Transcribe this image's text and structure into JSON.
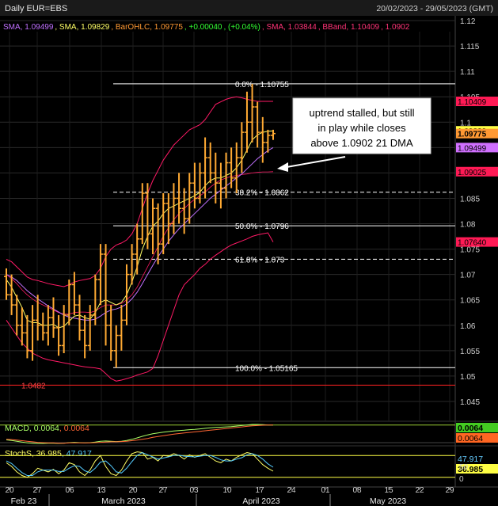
{
  "header": {
    "title": "Daily EUR=EBS",
    "date_range": "20/02/2023 - 29/05/2023 (GMT)"
  },
  "legend": [
    {
      "text": "SMA, 1.09499",
      "color": "#c070ff"
    },
    {
      "text": "SMA, 1.09829",
      "color": "#ffff66"
    },
    {
      "text": "BarOHLC, 1.09775",
      "color": "#ff9933"
    },
    {
      "text": "+0.00040",
      "color": "#33ff33"
    },
    {
      "text": "(+0.04%)",
      "color": "#33ff33"
    },
    {
      "text": "SMA, 1.03844",
      "color": "#ff3377"
    },
    {
      "text": "BBand, 1.10409",
      "color": "#ff3377"
    },
    {
      "text": "1.0902",
      "color": "#ff3377"
    }
  ],
  "annotation": {
    "lines": [
      "uptrend stalled, but still",
      "in play while closes",
      "above 1.0902 21 DMA"
    ]
  },
  "macd_panel": {
    "label": "MACD",
    "v1": "0.0064",
    "v2": "0.0064",
    "tag1": "0.0064",
    "tag2": "0.0064"
  },
  "stoch_panel": {
    "label": "StochS",
    "v1": "36.985",
    "v2": "47.917",
    "tag1": "47.917",
    "tag2": "36.985",
    "axis": [
      "50",
      "0"
    ]
  },
  "x_axis": {
    "days": [
      "20",
      "27",
      "06",
      "13",
      "20",
      "27",
      "03",
      "10",
      "17",
      "24",
      "01",
      "08",
      "15",
      "22",
      "29"
    ],
    "months": [
      "Feb 23",
      "March 2023",
      "April 2023",
      "May 2023"
    ]
  },
  "price_tags": [
    {
      "text": "1.09829",
      "value": 1.09829,
      "bg": "#ffff44",
      "fg": "#000"
    },
    {
      "text": "1.09775",
      "value": 1.09775,
      "bg": "#ff9933",
      "fg": "#000"
    },
    {
      "text": "1.09499",
      "value": 1.09499,
      "bg": "#d070ff",
      "fg": "#000"
    },
    {
      "text": "1.10409",
      "value": 1.10409,
      "bg": "#ff1a55",
      "fg": "#000"
    },
    {
      "text": "1.09025",
      "value": 1.09025,
      "bg": "#ff1a55",
      "fg": "#000"
    },
    {
      "text": "1.07640",
      "value": 1.0764,
      "bg": "#ff1a55",
      "fg": "#000"
    }
  ],
  "chart_data": {
    "type": "bar",
    "subtype": "ohlc",
    "ylim": [
      1.04,
      1.12
    ],
    "yticks": [
      1.045,
      1.05,
      1.055,
      1.06,
      1.065,
      1.07,
      1.075,
      1.08,
      1.085,
      1.09,
      1.095,
      1.1,
      1.105,
      1.11,
      1.115,
      1.12
    ],
    "ytick_labels": [
      "1.045",
      "1.05",
      "1.055",
      "1.06",
      "1.065",
      "1.07",
      "1.075",
      "1.08",
      "1.085",
      "1.09",
      "1.095",
      "1.1",
      "1.105",
      "1.11",
      "1.115",
      "1.12"
    ],
    "ohlc": [
      [
        1.0696,
        1.0712,
        1.065,
        1.066
      ],
      [
        1.066,
        1.07,
        1.062,
        1.064
      ],
      [
        1.064,
        1.066,
        1.058,
        1.06
      ],
      [
        1.06,
        1.0635,
        1.056,
        1.0585
      ],
      [
        1.0585,
        1.062,
        1.0535,
        1.055
      ],
      [
        1.055,
        1.064,
        1.053,
        1.061
      ],
      [
        1.061,
        1.066,
        1.057,
        1.06
      ],
      [
        1.06,
        1.0625,
        1.057,
        1.0585
      ],
      [
        1.0585,
        1.064,
        1.056,
        1.0615
      ],
      [
        1.0615,
        1.0655,
        1.0575,
        1.0595
      ],
      [
        1.0595,
        1.062,
        1.054,
        1.056
      ],
      [
        1.056,
        1.064,
        1.0545,
        1.062
      ],
      [
        1.062,
        1.069,
        1.06,
        1.068
      ],
      [
        1.068,
        1.0705,
        1.062,
        1.064
      ],
      [
        1.064,
        1.066,
        1.057,
        1.059
      ],
      [
        1.059,
        1.062,
        1.0535,
        1.056
      ],
      [
        1.056,
        1.064,
        1.055,
        1.062
      ],
      [
        1.062,
        1.07,
        1.06,
        1.069
      ],
      [
        1.069,
        1.076,
        1.064,
        1.074
      ],
      [
        1.074,
        1.076,
        1.056,
        1.06
      ],
      [
        1.06,
        1.064,
        1.053,
        1.055
      ],
      [
        1.055,
        1.06,
        1.05165,
        1.058
      ],
      [
        1.058,
        1.064,
        1.055,
        1.061
      ],
      [
        1.061,
        1.072,
        1.06,
        1.07
      ],
      [
        1.07,
        1.076,
        1.068,
        1.074
      ],
      [
        1.074,
        1.08,
        1.07,
        1.077
      ],
      [
        1.077,
        1.088,
        1.076,
        1.086
      ],
      [
        1.086,
        1.088,
        1.075,
        1.078
      ],
      [
        1.078,
        1.085,
        1.074,
        1.083
      ],
      [
        1.083,
        1.084,
        1.072,
        1.076
      ],
      [
        1.076,
        1.086,
        1.074,
        1.084
      ],
      [
        1.084,
        1.086,
        1.076,
        1.08
      ],
      [
        1.08,
        1.088,
        1.078,
        1.085
      ],
      [
        1.085,
        1.09,
        1.08,
        1.083
      ],
      [
        1.083,
        1.087,
        1.078,
        1.081
      ],
      [
        1.081,
        1.09,
        1.08,
        1.088
      ],
      [
        1.088,
        1.092,
        1.083,
        1.085
      ],
      [
        1.085,
        1.092,
        1.084,
        1.09
      ],
      [
        1.09,
        1.097,
        1.085,
        1.093
      ],
      [
        1.093,
        1.096,
        1.088,
        1.09
      ],
      [
        1.09,
        1.094,
        1.084,
        1.088
      ],
      [
        1.088,
        1.092,
        1.083,
        1.087
      ],
      [
        1.087,
        1.094,
        1.085,
        1.092
      ],
      [
        1.092,
        1.095,
        1.087,
        1.089
      ],
      [
        1.089,
        1.096,
        1.086,
        1.093
      ],
      [
        1.093,
        1.1,
        1.09,
        1.098
      ],
      [
        1.098,
        1.106,
        1.094,
        1.1
      ],
      [
        1.1,
        1.1075,
        1.096,
        1.103
      ],
      [
        1.103,
        1.104,
        1.095,
        1.098
      ],
      [
        1.098,
        1.101,
        1.092,
        1.096
      ],
      [
        1.096,
        1.0985,
        1.094,
        1.0974
      ],
      [
        1.0974,
        1.0985,
        1.0965,
        1.09775
      ]
    ],
    "sma_fast": [
      1.069,
      1.0675,
      1.0655,
      1.0635,
      1.061,
      1.0605,
      1.0605,
      1.06,
      1.06,
      1.0602,
      1.0595,
      1.0598,
      1.0608,
      1.0618,
      1.062,
      1.0615,
      1.0612,
      1.0625,
      1.0645,
      1.065,
      1.0645,
      1.064,
      1.0645,
      1.066,
      1.0685,
      1.0715,
      1.075,
      1.0775,
      1.0795,
      1.0805,
      1.082,
      1.083,
      1.0835,
      1.084,
      1.0845,
      1.085,
      1.0855,
      1.0862,
      1.0875,
      1.0885,
      1.089,
      1.089,
      1.0895,
      1.09,
      1.091,
      1.0925,
      1.0945,
      1.0965,
      1.0975,
      1.098,
      1.0982,
      1.09829
    ],
    "sma_slow": [
      1.07,
      1.0695,
      1.0688,
      1.0678,
      1.0668,
      1.066,
      1.0652,
      1.0645,
      1.0638,
      1.0632,
      1.0626,
      1.062,
      1.0616,
      1.0614,
      1.0612,
      1.061,
      1.061,
      1.0612,
      1.0618,
      1.0625,
      1.063,
      1.0632,
      1.0636,
      1.0642,
      1.0652,
      1.0665,
      1.0682,
      1.07,
      1.0718,
      1.0735,
      1.075,
      1.0765,
      1.0778,
      1.079,
      1.08,
      1.081,
      1.082,
      1.083,
      1.084,
      1.085,
      1.0858,
      1.0866,
      1.0874,
      1.0882,
      1.089,
      1.0898,
      1.0908,
      1.0918,
      1.0928,
      1.0936,
      1.0944,
      1.09499
    ],
    "bband_upper": [
      1.073,
      1.0725,
      1.0715,
      1.0705,
      1.0695,
      1.069,
      1.0688,
      1.0685,
      1.0682,
      1.068,
      1.0678,
      1.0676,
      1.068,
      1.0685,
      1.0688,
      1.069,
      1.0692,
      1.0698,
      1.0712,
      1.0735,
      1.075,
      1.0758,
      1.0762,
      1.0768,
      1.078,
      1.08,
      1.083,
      1.086,
      1.0885,
      1.0905,
      1.0925,
      1.094,
      1.0955,
      1.0965,
      1.0975,
      1.0985,
      1.099,
      1.0995,
      1.1005,
      1.102,
      1.1035,
      1.104,
      1.1045,
      1.1048,
      1.105,
      1.1048,
      1.1045,
      1.1043,
      1.1041,
      1.1041,
      1.1041,
      1.10409
    ],
    "bband_lower": [
      1.061,
      1.0595,
      1.058,
      1.0565,
      1.0555,
      1.0545,
      1.054,
      1.0535,
      1.0532,
      1.053,
      1.0528,
      1.0526,
      1.0524,
      1.0522,
      1.052,
      1.0518,
      1.0517,
      1.0516,
      1.0514,
      1.0505,
      1.0495,
      1.049,
      1.0492,
      1.0495,
      1.0498,
      1.0502,
      1.0505,
      1.0508,
      1.0515,
      1.054,
      1.057,
      1.06,
      1.063,
      1.066,
      1.068,
      1.069,
      1.07,
      1.0712,
      1.072,
      1.073,
      1.0738,
      1.0745,
      1.0752,
      1.0758,
      1.0762,
      1.0766,
      1.077,
      1.0775,
      1.0778,
      1.078,
      1.0782,
      1.0764
    ],
    "bband_mid": [
      1.07,
      1.0692,
      1.0682,
      1.067,
      1.066,
      1.0652,
      1.0645,
      1.064,
      1.0635,
      1.063,
      1.0625,
      1.0622,
      1.0622,
      1.0625,
      1.0626,
      1.0626,
      1.0625,
      1.0628,
      1.0635,
      1.064,
      1.064,
      1.064,
      1.0643,
      1.065,
      1.066,
      1.0675,
      1.0695,
      1.0715,
      1.0735,
      1.0755,
      1.0775,
      1.0792,
      1.0808,
      1.082,
      1.083,
      1.084,
      1.0848,
      1.0855,
      1.0862,
      1.0872,
      1.088,
      1.0886,
      1.089,
      1.0893,
      1.0895,
      1.0897,
      1.0898,
      1.09,
      1.0901,
      1.0902,
      1.0902,
      1.09025
    ],
    "fib_levels": [
      {
        "label": "0.0% - 1.10755",
        "value": 1.10755,
        "style": "solid"
      },
      {
        "label": "38.2% - 1.0862",
        "value": 1.0862,
        "style": "dashed"
      },
      {
        "label": "50.0% - 1.0796",
        "value": 1.0796,
        "style": "solid"
      },
      {
        "label": "61.8% - 1.073",
        "value": 1.073,
        "style": "dashed"
      },
      {
        "label": "100.0% - 1.05165",
        "value": 1.05165,
        "style": "solid"
      }
    ],
    "hline": {
      "label": "1.0482",
      "value": 1.0482,
      "color": "#ff2222"
    },
    "macd": [
      0.001,
      0.0008,
      0.0005,
      0.0002,
      -0.0001,
      -0.0002,
      -0.0003,
      -0.0003,
      -0.0002,
      -0.0002,
      -0.0003,
      -0.0002,
      0.0,
      0.0001,
      0.0,
      -0.0001,
      0.0,
      0.0002,
      0.0005,
      0.0006,
      0.0005,
      0.0004,
      0.0005,
      0.0008,
      0.0012,
      0.0017,
      0.0023,
      0.0028,
      0.0032,
      0.0035,
      0.0038,
      0.004,
      0.0042,
      0.0044,
      0.0045,
      0.0047,
      0.0048,
      0.005,
      0.0052,
      0.0054,
      0.0055,
      0.0056,
      0.0057,
      0.0058,
      0.006,
      0.0062,
      0.0064,
      0.0066,
      0.0066,
      0.0065,
      0.0064,
      0.0064
    ],
    "macd_signal": [
      0.0012,
      0.0011,
      0.0009,
      0.0007,
      0.0005,
      0.0003,
      0.0001,
      0.0,
      -0.0001,
      -0.0001,
      -0.0002,
      -0.0002,
      -0.0001,
      -0.0001,
      -0.0001,
      -0.0001,
      -0.0001,
      0.0,
      0.0001,
      0.0002,
      0.0003,
      0.0003,
      0.0004,
      0.0005,
      0.0007,
      0.0009,
      0.0012,
      0.0015,
      0.0019,
      0.0022,
      0.0025,
      0.0028,
      0.0031,
      0.0033,
      0.0035,
      0.0037,
      0.0039,
      0.0041,
      0.0043,
      0.0045,
      0.0047,
      0.0049,
      0.0051,
      0.0053,
      0.0055,
      0.0057,
      0.0059,
      0.0061,
      0.0062,
      0.0063,
      0.0064,
      0.0064
    ],
    "stoch_k": [
      60,
      50,
      35,
      25,
      20,
      30,
      45,
      40,
      35,
      42,
      30,
      40,
      60,
      55,
      35,
      25,
      40,
      65,
      80,
      50,
      30,
      25,
      40,
      65,
      85,
      90,
      88,
      70,
      75,
      65,
      80,
      78,
      85,
      80,
      70,
      82,
      75,
      80,
      85,
      75,
      65,
      60,
      70,
      65,
      75,
      82,
      88,
      85,
      70,
      55,
      45,
      36.985
    ],
    "stoch_d": [
      65,
      58,
      45,
      33,
      25,
      25,
      35,
      40,
      40,
      40,
      36,
      36,
      45,
      52,
      50,
      38,
      33,
      45,
      62,
      65,
      52,
      35,
      32,
      45,
      63,
      80,
      88,
      82,
      76,
      70,
      73,
      76,
      80,
      81,
      78,
      77,
      76,
      78,
      80,
      80,
      75,
      68,
      65,
      65,
      70,
      74,
      82,
      85,
      80,
      70,
      57,
      47.917
    ]
  }
}
